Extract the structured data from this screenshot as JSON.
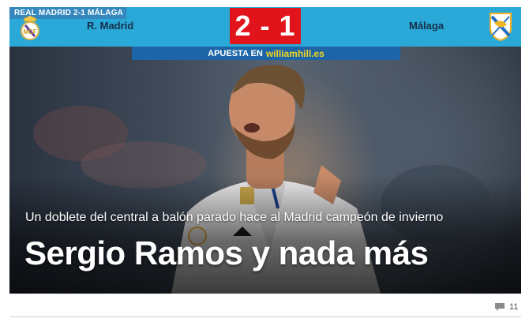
{
  "scoreboard": {
    "ticker": "REAL MADRID 2-1 MÁLAGA",
    "home_team": "R. Madrid",
    "away_team": "Málaga",
    "score": "2 - 1",
    "home_crest": "real-madrid-crest",
    "away_crest": "malaga-crest"
  },
  "bet_banner": {
    "prefix": "APUESTA EN",
    "brand": "williamhill.es"
  },
  "article": {
    "subtitle": "Un doblete del central a balón parado hace al Madrid campeón de invierno",
    "headline": "Sergio Ramos y nada más"
  },
  "comments": {
    "icon": "comment-bubble-icon",
    "count": "11"
  },
  "colors": {
    "scoreboard_bg": "#2aa8d8",
    "score_bg": "#e2141b",
    "banner_bg": "#1c66a8",
    "brand_yellow": "#f4d21e"
  }
}
